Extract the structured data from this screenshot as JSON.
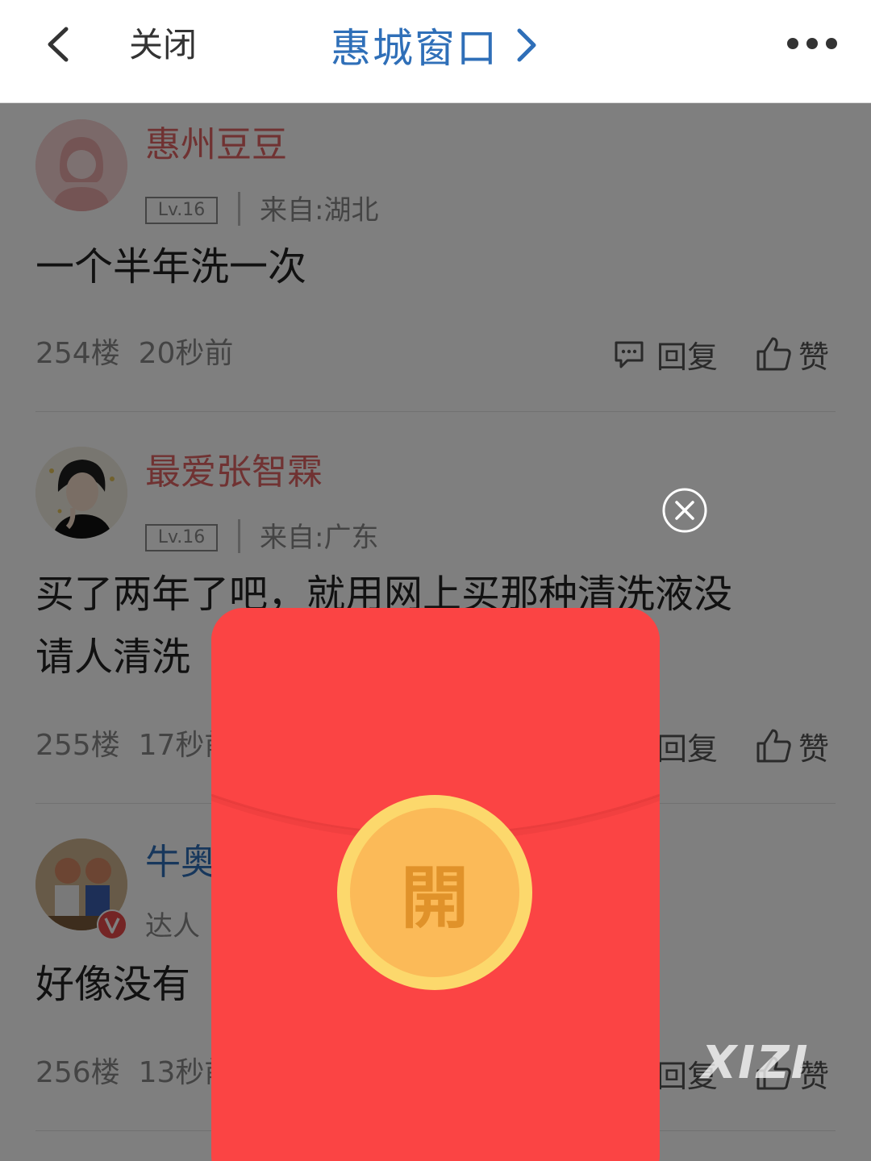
{
  "header": {
    "close_label": "关闭",
    "title": "惠城窗口",
    "icons": [
      "back-icon",
      "chevron-right-icon",
      "more-icon"
    ]
  },
  "posts": [
    {
      "username": "惠州豆豆",
      "username_color": "#e06565",
      "level": "Lv.16",
      "location": "来自:湖北",
      "body": "一个半年洗一次",
      "floor": "254楼",
      "time": "20秒前",
      "reply_label": "回复",
      "like_label": "赞"
    },
    {
      "username": "最爱张智霖",
      "username_color": "#e06565",
      "level": "Lv.16",
      "location": "来自:广东",
      "body": "买了两年了吧，就用网上买那种清洗液没请人清洗过",
      "body_visible_line1": "买了两年了吧，就用网上买那种清洗液没",
      "body_visible_line2": "请人清洗",
      "floor": "255楼",
      "time": "17秒前",
      "reply_label": "回复",
      "like_label": "赞"
    },
    {
      "username": "牛奥",
      "username_color": "#2f6fb8",
      "tag": "达人",
      "body": "好像没有",
      "floor": "256楼",
      "time": "13秒前",
      "reply_label": "回复",
      "like_label": "赞"
    }
  ],
  "red_packet": {
    "open_label": "開",
    "envelope_color": "#fb4444",
    "coin_color": "#fbba58"
  },
  "watermark": "XIZI",
  "colors": {
    "accent_blue": "#2f6fb8",
    "username_red": "#e06565",
    "overlay": "rgba(0,0,0,0.5)"
  }
}
